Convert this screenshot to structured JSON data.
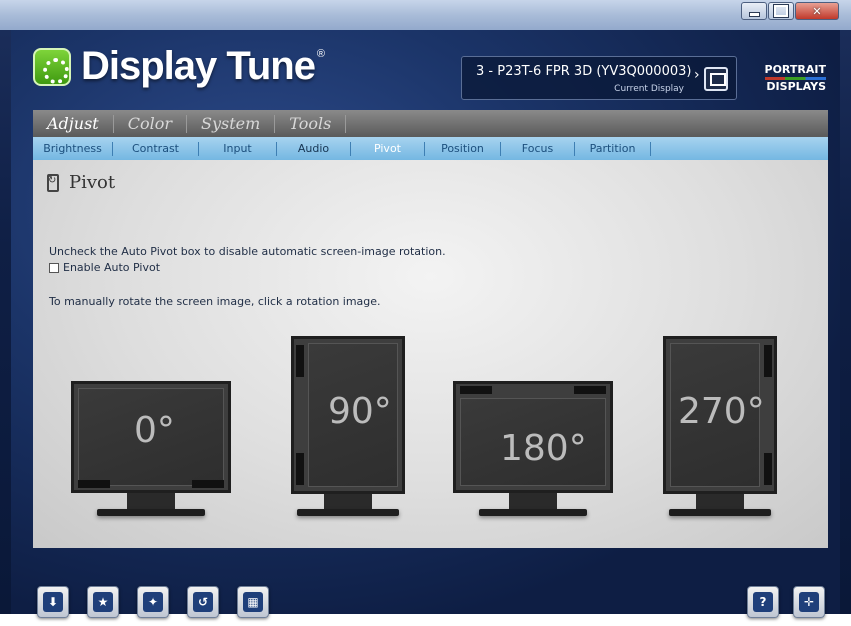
{
  "window": {
    "controls": [
      "minimize",
      "maximize",
      "close"
    ]
  },
  "app": {
    "title_bold": "Display Tune",
    "registered_mark": "®",
    "current_display_name": "3 - P23T-6 FPR 3D (YV3Q000003)",
    "current_display_label": "Current Display",
    "next_arrow": "›",
    "brand_line1": "PORTRAIT",
    "brand_line2": "DISPLAYS"
  },
  "tabs": [
    {
      "label": "Adjust",
      "active": true
    },
    {
      "label": "Color",
      "active": false
    },
    {
      "label": "System",
      "active": false
    },
    {
      "label": "Tools",
      "active": false
    }
  ],
  "subtabs": [
    {
      "label": "Brightness"
    },
    {
      "label": "Contrast"
    },
    {
      "label": "Input"
    },
    {
      "label": "Audio"
    },
    {
      "label": "Pivot",
      "active": true
    },
    {
      "label": "Position"
    },
    {
      "label": "Focus"
    },
    {
      "label": "Partition"
    }
  ],
  "pivot": {
    "title": "Pivot",
    "instruction_auto": "Uncheck the Auto Pivot box to disable automatic screen-image rotation.",
    "checkbox_label": "Enable Auto Pivot",
    "checkbox_checked": false,
    "instruction_manual": "To manually rotate the screen image, click a rotation image.",
    "rotations": [
      {
        "label": "0°"
      },
      {
        "label": "90°"
      },
      {
        "label": "180°"
      },
      {
        "label": "270°"
      }
    ]
  },
  "toolbar": {
    "left_buttons": [
      "download-icon",
      "star-icon",
      "monitor-star-icon",
      "reset-icon",
      "keyboard-icon"
    ],
    "right_buttons": [
      "help-icon",
      "lifebuoy-icon"
    ],
    "help_glyph": "?"
  },
  "colors": {
    "subtab_bar": "#74b7e2",
    "subtab_text": "#1c4f7d",
    "accent_green": "#3f9a10",
    "window_bg": "#1b3468"
  }
}
